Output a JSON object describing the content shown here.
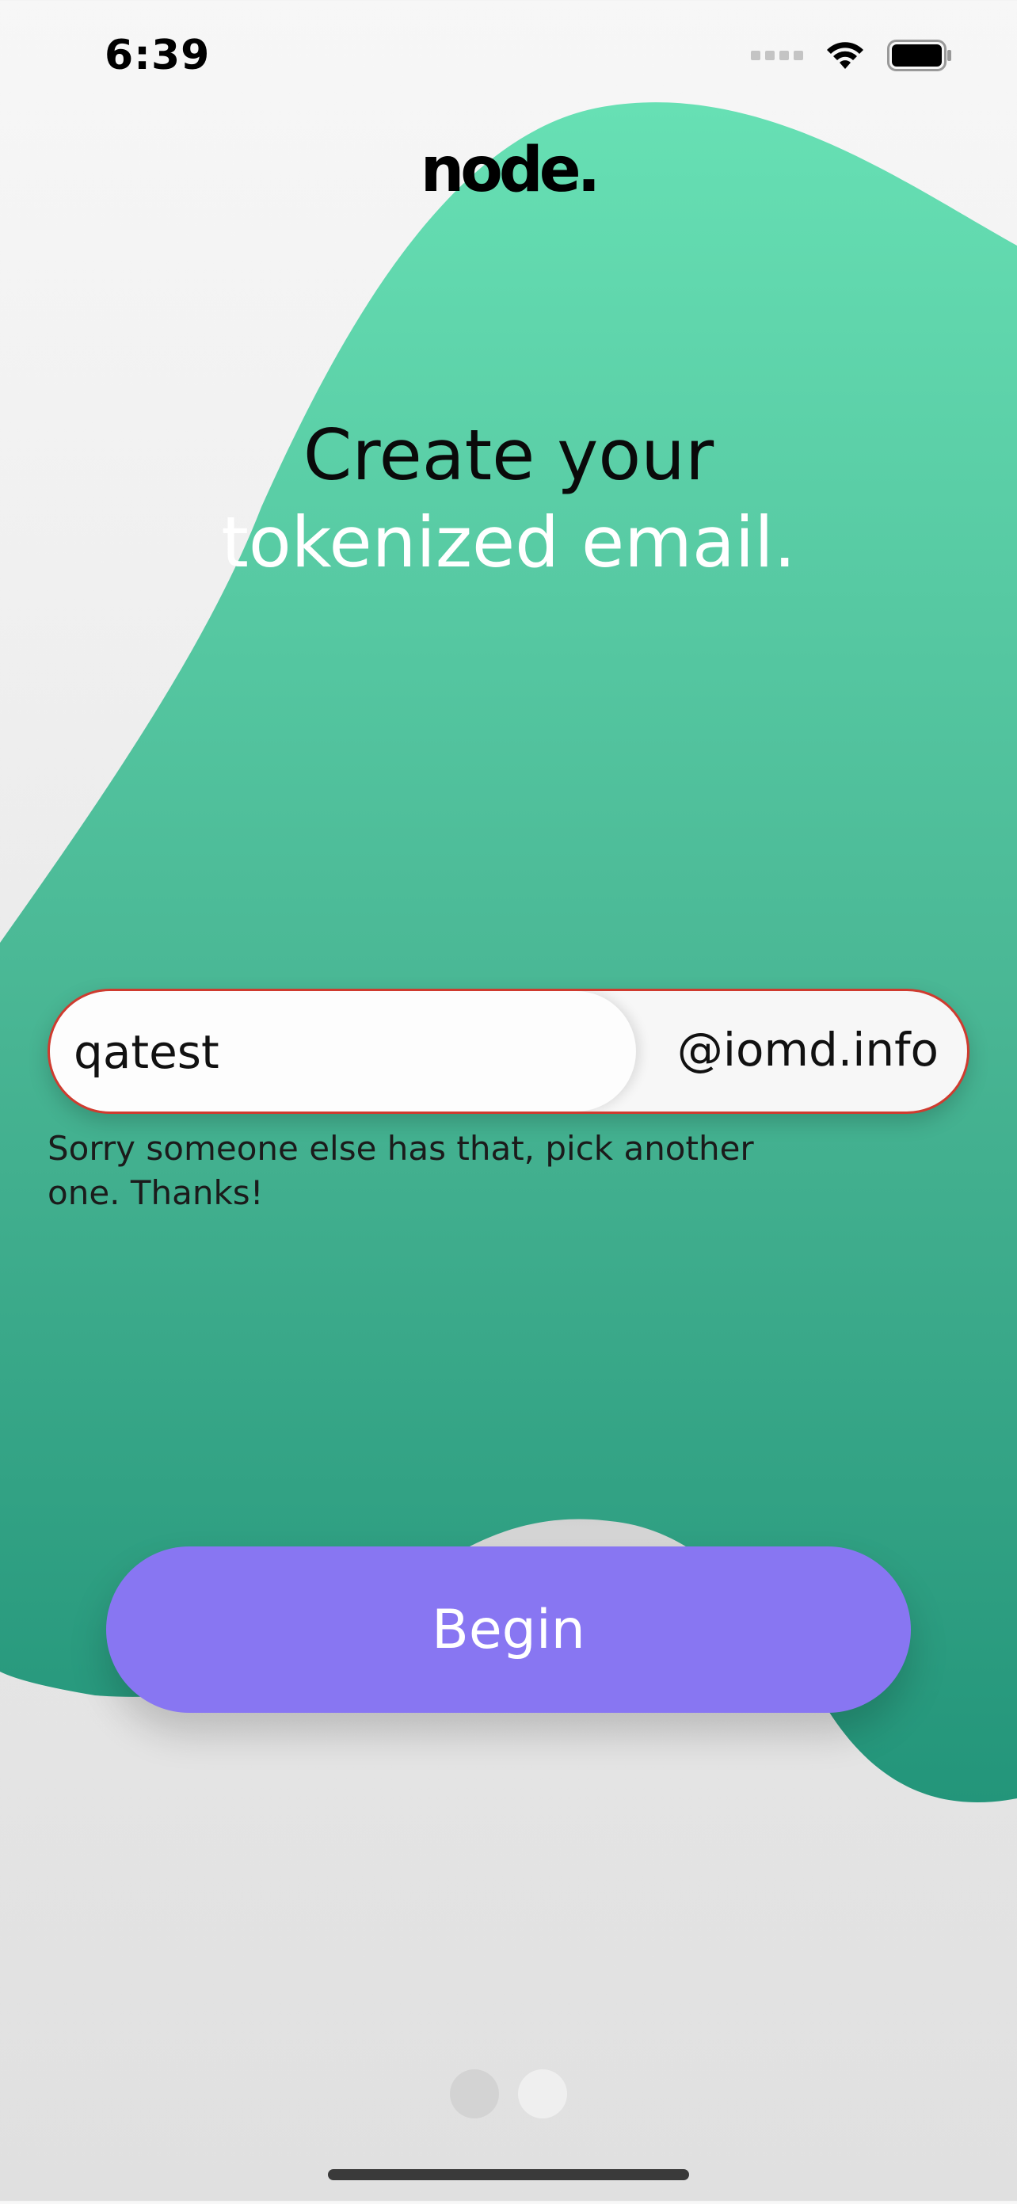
{
  "status_bar": {
    "time": "6:39",
    "icons": [
      "signal-icon",
      "wifi-icon",
      "battery-icon"
    ]
  },
  "logo": {
    "text": "node."
  },
  "heading": {
    "line1": "Create your",
    "line2": "tokenized email."
  },
  "email": {
    "value": "qatest",
    "domain": "@iomd.info",
    "error": "Sorry someone else has that, pick another one. Thanks!"
  },
  "begin_button": {
    "label": "Begin"
  },
  "pager": {
    "count": 2,
    "active_index": 1
  },
  "colors": {
    "blob_top": "#67e0b4",
    "blob_bottom": "#23957a",
    "button": "#8876f2",
    "error_border": "#cf3b2f"
  }
}
